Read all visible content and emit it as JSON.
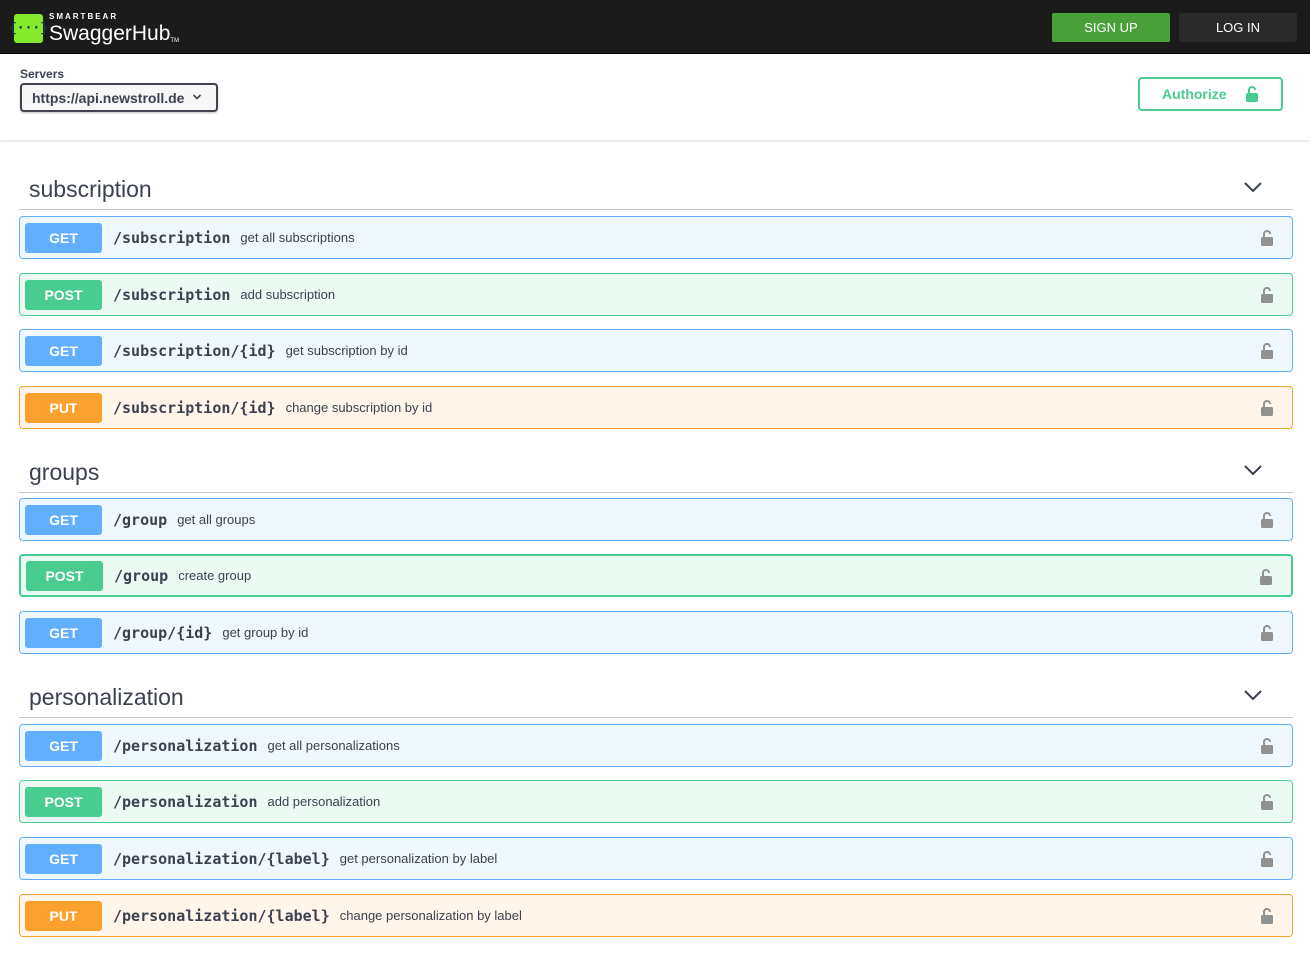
{
  "topbar": {
    "logo_glyph": "{···}",
    "logo_brand": "SMARTBEAR",
    "logo_product": "SwaggerHub",
    "logo_tm": "TM",
    "signup_label": "SIGN UP",
    "login_label": "LOG IN"
  },
  "servers": {
    "label": "Servers",
    "selected": "https://api.newstroll.de",
    "authorize_label": "Authorize"
  },
  "sections": [
    {
      "title": "subscription",
      "operations": [
        {
          "method": "GET",
          "path": "/subscription",
          "summary": "get all subscriptions"
        },
        {
          "method": "POST",
          "path": "/subscription",
          "summary": "add subscription"
        },
        {
          "method": "GET",
          "path": "/subscription/{id}",
          "summary": "get subscription by id"
        },
        {
          "method": "PUT",
          "path": "/subscription/{id}",
          "summary": "change subscription by id"
        }
      ]
    },
    {
      "title": "groups",
      "operations": [
        {
          "method": "GET",
          "path": "/group",
          "summary": "get all groups"
        },
        {
          "method": "POST",
          "path": "/group",
          "summary": "create group"
        },
        {
          "method": "GET",
          "path": "/group/{id}",
          "summary": "get group by id"
        }
      ]
    },
    {
      "title": "personalization",
      "operations": [
        {
          "method": "GET",
          "path": "/personalization",
          "summary": "get all personalizations"
        },
        {
          "method": "POST",
          "path": "/personalization",
          "summary": "add personalization"
        },
        {
          "method": "GET",
          "path": "/personalization/{label}",
          "summary": "get personalization by label"
        },
        {
          "method": "PUT",
          "path": "/personalization/{label}",
          "summary": "change personalization by label"
        }
      ]
    }
  ],
  "colors": {
    "get": "#61affe",
    "post": "#49cc90",
    "put": "#fca130",
    "topbar": "#1b1b1b",
    "signup": "#49a03a",
    "logo": "#85ea2d"
  },
  "icons": {
    "section_toggle": "chevron-down-icon",
    "operation_lock": "lock-icon",
    "authorize_lock": "unlocked-icon"
  }
}
